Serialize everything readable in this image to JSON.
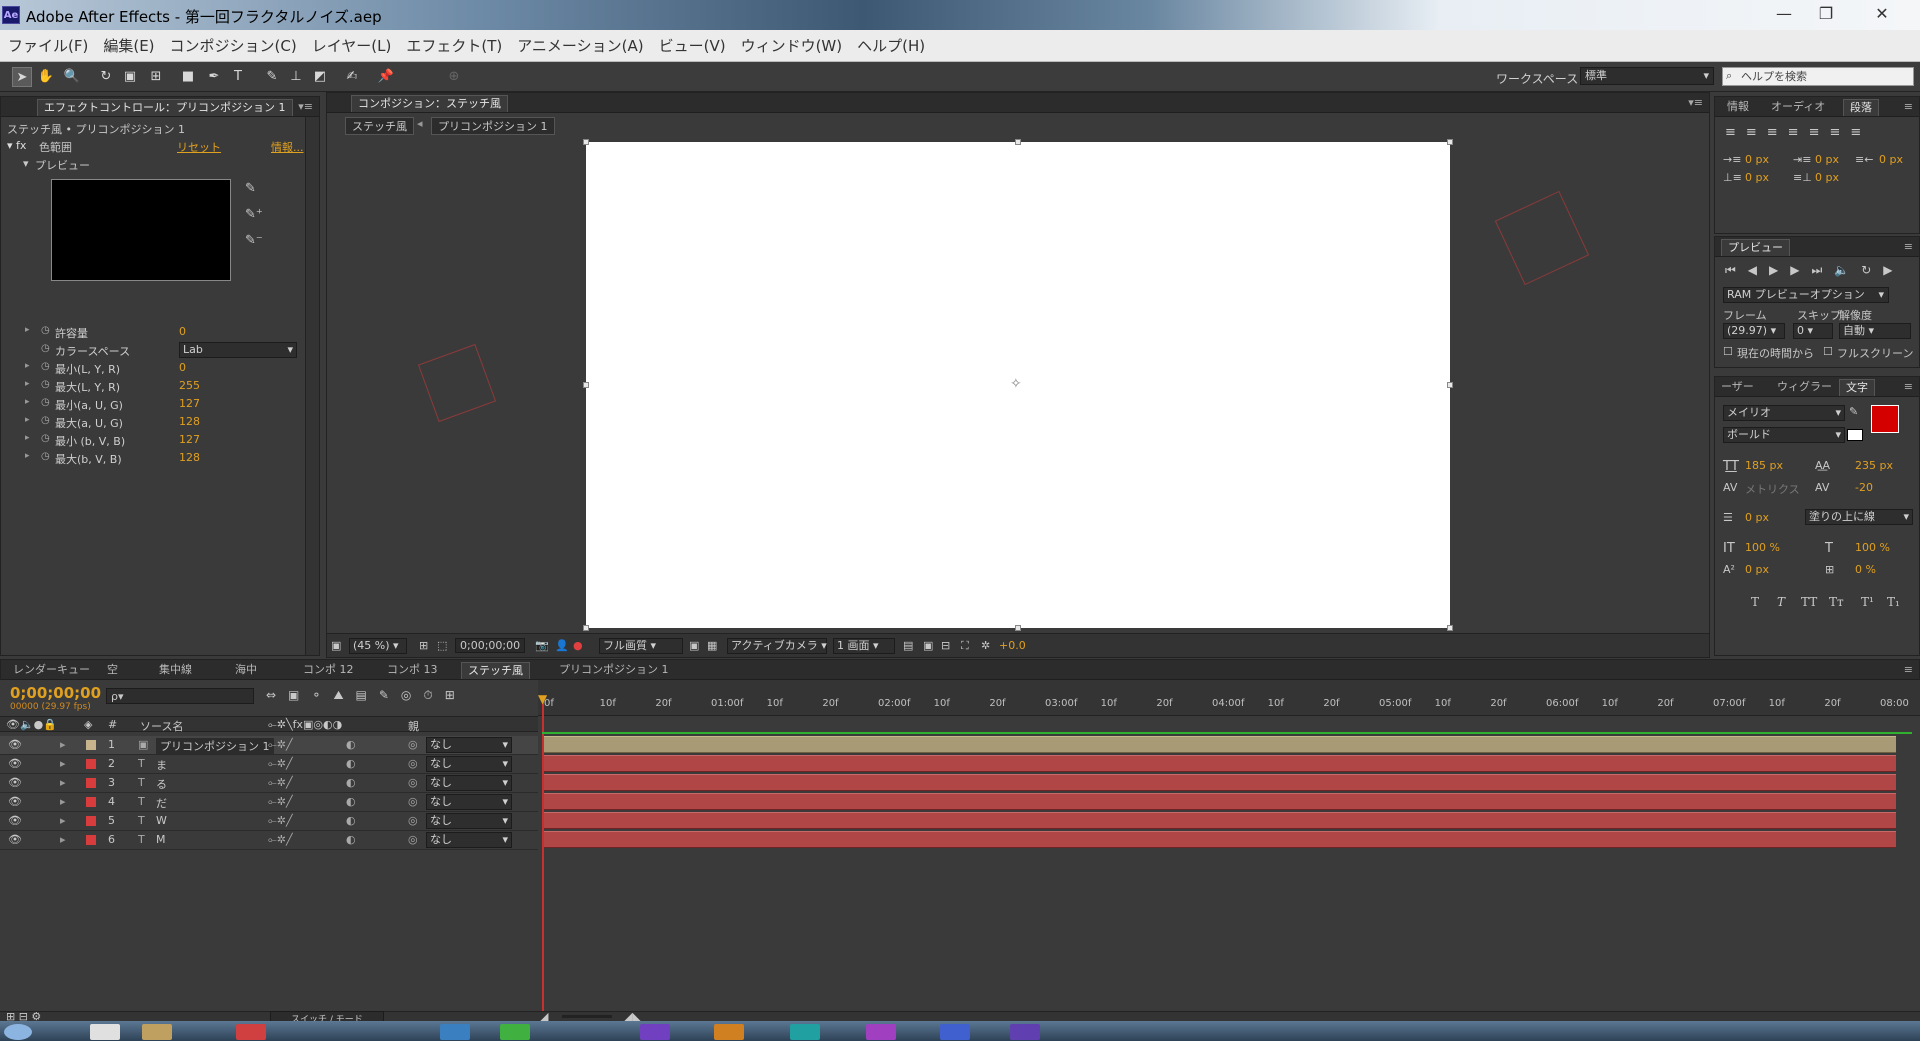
{
  "window": {
    "title": "Adobe After Effects - 第一回フラクタルノイズ.aep",
    "logo": "Ae",
    "minimize": "—",
    "restore": "❐",
    "close": "✕"
  },
  "menu": [
    "ファイル(F)",
    "編集(E)",
    "コンポジション(C)",
    "レイヤー(L)",
    "エフェクト(T)",
    "アニメーション(A)",
    "ビュー(V)",
    "ウィンドウ(W)",
    "ヘルプ(H)"
  ],
  "toolbar": {
    "tools": [
      "selection-tool",
      "hand-tool",
      "zoom-tool",
      "rotate-tool",
      "camera-orbit-tool",
      "pan-behind-tool",
      "rectangle-tool",
      "pen-tool",
      "type-tool",
      "brush-tool",
      "clone-stamp-tool",
      "eraser-tool",
      "roto-brush-tool",
      "puppet-pin-tool"
    ],
    "workspace_label": "ワークスペース：",
    "workspace_value": "標準",
    "help_placeholder": "ヘルプを検索"
  },
  "effect_controls": {
    "tab": "エフェクトコントロール：プリコンポジション 1",
    "subtitle": "ステッチ風 • プリコンポジション 1",
    "effect_name": "色範囲",
    "reset": "リセット",
    "about": "情報...",
    "preview_label": "プレビュー",
    "params": [
      {
        "label": "許容量",
        "value": "0",
        "expander": true
      },
      {
        "label": "カラースペース",
        "value": "Lab",
        "dropdown": true
      },
      {
        "label": "最小(L, Y, R)",
        "value": "0",
        "expander": true
      },
      {
        "label": "最大(L, Y, R)",
        "value": "255",
        "expander": true
      },
      {
        "label": "最小(a, U, G)",
        "value": "127",
        "expander": true
      },
      {
        "label": "最大(a, U, G)",
        "value": "128",
        "expander": true
      },
      {
        "label": "最小 (b, V, B)",
        "value": "127",
        "expander": true
      },
      {
        "label": "最大(b, V, B)",
        "value": "128",
        "expander": true
      }
    ]
  },
  "composition": {
    "tab": "コンポジション：ステッチ風",
    "breadcrumb_current": "ステッチ風",
    "breadcrumb_next": "プリコンポジション 1",
    "zoom": "(45 %)",
    "timecode": "0;00;00;00",
    "quality": "フル画質",
    "camera": "アクティブカメラ",
    "views": "1 画面",
    "exposure": "+0.0",
    "canvas_color": "#ffffff"
  },
  "info_panel": {
    "tabs": [
      "情報",
      "オーディオ",
      "段落"
    ],
    "active_tab": "段落",
    "indent_values": [
      "0 px",
      "0 px",
      "0 px",
      "0 px",
      "0 px"
    ]
  },
  "preview_panel": {
    "tab": "プレビュー",
    "ram_option": "RAM プレビューオプション",
    "frame_label": "フレーム",
    "skip_label": "スキップ",
    "res_label": "解像度",
    "frame_value": "(29.97)",
    "skip_value": "0",
    "res_value": "自動",
    "from_current": "現在の時間から",
    "fullscreen": "フルスクリーン"
  },
  "character_panel": {
    "tabs": [
      "ーザー",
      "ウィグラー",
      "文字"
    ],
    "active_tab": "文字",
    "font": "メイリオ",
    "style": "ボールド",
    "size": "185 px",
    "leading": "235 px",
    "kerning": "メトリクス",
    "tracking": "-20",
    "stroke": "0 px",
    "stroke_mode": "塗りの上に線",
    "v_scale": "100 %",
    "h_scale": "100 %",
    "baseline": "0 px",
    "tsume": "0 %",
    "fill_color": "#d40000",
    "style_buttons": [
      "T",
      "T",
      "TT",
      "Tт",
      "T¹",
      "T₁"
    ]
  },
  "timeline": {
    "tabs": [
      "レンダーキュー",
      "空",
      "集中線",
      "海中",
      "コンポ 12",
      "コンポ 13",
      "ステッチ風",
      "プリコンポジション 1"
    ],
    "active_tab": "ステッチ風",
    "timecode": "0;00;00;00",
    "fps": "00000 (29.97 fps)",
    "search_placeholder": "ρ▾",
    "col_hash": "#",
    "col_source": "ソース名",
    "col_parent": "親",
    "ruler": [
      "0f",
      "10f",
      "20f",
      "01:00f",
      "10f",
      "20f",
      "02:00f",
      "10f",
      "20f",
      "03:00f",
      "10f",
      "20f",
      "04:00f",
      "10f",
      "20f",
      "05:00f",
      "10f",
      "20f",
      "06:00f",
      "10f",
      "20f",
      "07:00f",
      "10f",
      "20f",
      "08:00"
    ],
    "layers": [
      {
        "num": "1",
        "name": "プリコンポジション 1",
        "parent": "なし",
        "color": "#c8b48c",
        "type": "comp"
      },
      {
        "num": "2",
        "name": "ま",
        "parent": "なし",
        "color": "#d83c3c",
        "type": "text"
      },
      {
        "num": "3",
        "name": "る",
        "parent": "なし",
        "color": "#d83c3c",
        "type": "text"
      },
      {
        "num": "4",
        "name": "だ",
        "parent": "なし",
        "color": "#d83c3c",
        "type": "text"
      },
      {
        "num": "5",
        "name": "W",
        "parent": "なし",
        "color": "#d83c3c",
        "type": "text"
      },
      {
        "num": "6",
        "name": "M",
        "parent": "なし",
        "color": "#d83c3c",
        "type": "text"
      }
    ],
    "switch_mode": "スイッチ / モード"
  }
}
